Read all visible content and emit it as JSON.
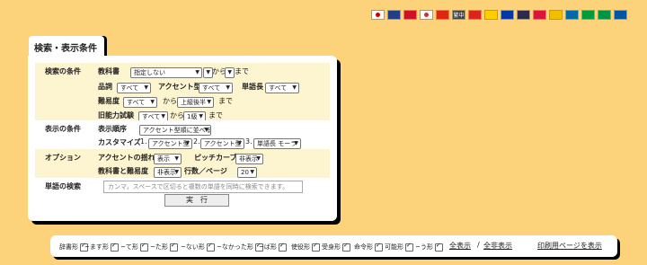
{
  "flags": [
    {
      "name": "japan-flag",
      "color": "#ffffff",
      "mark": "#cc0000"
    },
    {
      "name": "uk-flag",
      "color": "#1f3f8a"
    },
    {
      "name": "indonesia-flag",
      "color": "#ce1126"
    },
    {
      "name": "korea-flag",
      "color": "#ffffff",
      "mark": "#cd2e3a"
    },
    {
      "name": "china-flag",
      "color": "#de2910"
    },
    {
      "name": "traditional-chinese-flag",
      "color": "#444444",
      "label": "繁中"
    },
    {
      "name": "vietnam-flag",
      "color": "#da251d"
    },
    {
      "name": "germany-flag",
      "color": "#ffce00"
    },
    {
      "name": "russia-flag",
      "color": "#0039a6"
    },
    {
      "name": "thailand-flag",
      "color": "#2d2a4a"
    },
    {
      "name": "poland-flag",
      "color": "#dc143c"
    },
    {
      "name": "spain-flag",
      "color": "#f1bf00"
    },
    {
      "name": "sweden-flag",
      "color": "#006aa7"
    },
    {
      "name": "brazil-flag",
      "color": "#009c3b"
    },
    {
      "name": "italy-flag",
      "color": "#009246"
    },
    {
      "name": "france-flag",
      "color": "#0055a4"
    }
  ],
  "tab_title": "検索・表示条件",
  "search": {
    "section": "検索の条件",
    "textbook_label": "教科書",
    "textbook_value": "指定しない",
    "from_text": "から",
    "to_text": "まで",
    "part_label": "品詞",
    "part_value": "すべて",
    "accent_label": "アクセント型",
    "accent_value": "すべて",
    "length_label": "単語長",
    "length_value": "すべて",
    "difficulty_label": "難易度",
    "difficulty_value": "すべて",
    "difficulty_to": "上級後半",
    "jlpt_label": "旧能力試験",
    "jlpt_value": "すべて",
    "jlpt_to": "1級"
  },
  "display": {
    "section": "表示の条件",
    "order_label": "表示順序",
    "order_value": "アクセント型順に並べる",
    "custom_label": "カスタマイズ",
    "n1": "1.",
    "c1": "アクセント型",
    "n2": "2.",
    "c2": "アクセント型",
    "n3": "3.",
    "c3": "単語長 モーラ"
  },
  "options": {
    "section": "オプション",
    "sway_label": "アクセントの揺れ",
    "sway_value": "表示",
    "pitch_label": "ピッチカーブ",
    "pitch_value": "非表示",
    "textbook_diff_label": "教科書と難易度",
    "textbook_diff_value": "非表示",
    "rows_label": "行数／ページ",
    "rows_value": "20"
  },
  "word_search": {
    "section": "単語の検索",
    "placeholder": "カンマ，スペースで区切ると複数の単語を同時に検索できます。"
  },
  "run_button": "実　行",
  "forms": [
    "辞書形",
    "~ます形",
    "~て形",
    "~た形",
    "~ない形",
    "~なかった形",
    "~ば形",
    "使役形",
    "受身形",
    "命令形",
    "可能形",
    "~う形"
  ],
  "show_all": "全表示",
  "separator": "/",
  "hide_all": "全非表示",
  "print_link": "印刷用ページを表示"
}
